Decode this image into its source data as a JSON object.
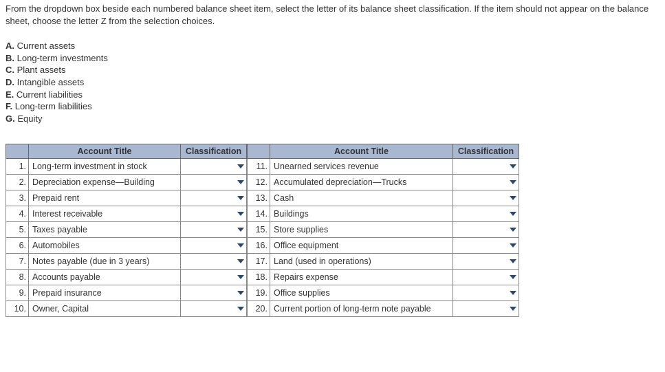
{
  "instructions": "From the dropdown box beside each numbered balance sheet item, select the letter of its balance sheet classification. If the item should not appear on the balance sheet, choose the letter Z from the selection choices.",
  "legend": [
    {
      "letter": "A.",
      "text": "Current assets"
    },
    {
      "letter": "B.",
      "text": "Long-term investments"
    },
    {
      "letter": "C.",
      "text": "Plant assets"
    },
    {
      "letter": "D.",
      "text": "Intangible assets"
    },
    {
      "letter": "E.",
      "text": "Current liabilities"
    },
    {
      "letter": "F.",
      "text": "Long-term liabilities"
    },
    {
      "letter": "G.",
      "text": "Equity"
    }
  ],
  "headers": {
    "account_title": "Account Title",
    "classification": "Classification"
  },
  "left_rows": [
    {
      "n": "1.",
      "t": "Long-term investment in stock"
    },
    {
      "n": "2.",
      "t": "Depreciation expense—Building"
    },
    {
      "n": "3.",
      "t": "Prepaid rent"
    },
    {
      "n": "4.",
      "t": "Interest receivable"
    },
    {
      "n": "5.",
      "t": "Taxes payable"
    },
    {
      "n": "6.",
      "t": "Automobiles"
    },
    {
      "n": "7.",
      "t": "Notes payable (due in 3 years)"
    },
    {
      "n": "8.",
      "t": "Accounts payable"
    },
    {
      "n": "9.",
      "t": "Prepaid insurance"
    },
    {
      "n": "10.",
      "t": "Owner, Capital"
    }
  ],
  "right_rows": [
    {
      "n": "11.",
      "t": "Unearned services revenue"
    },
    {
      "n": "12.",
      "t": "Accumulated depreciation—Trucks"
    },
    {
      "n": "13.",
      "t": "Cash"
    },
    {
      "n": "14.",
      "t": "Buildings"
    },
    {
      "n": "15.",
      "t": "Store supplies"
    },
    {
      "n": "16.",
      "t": "Office equipment"
    },
    {
      "n": "17.",
      "t": "Land (used in operations)"
    },
    {
      "n": "18.",
      "t": "Repairs expense"
    },
    {
      "n": "19.",
      "t": "Office supplies"
    },
    {
      "n": "20.",
      "t": "Current portion of long-term note payable"
    }
  ]
}
